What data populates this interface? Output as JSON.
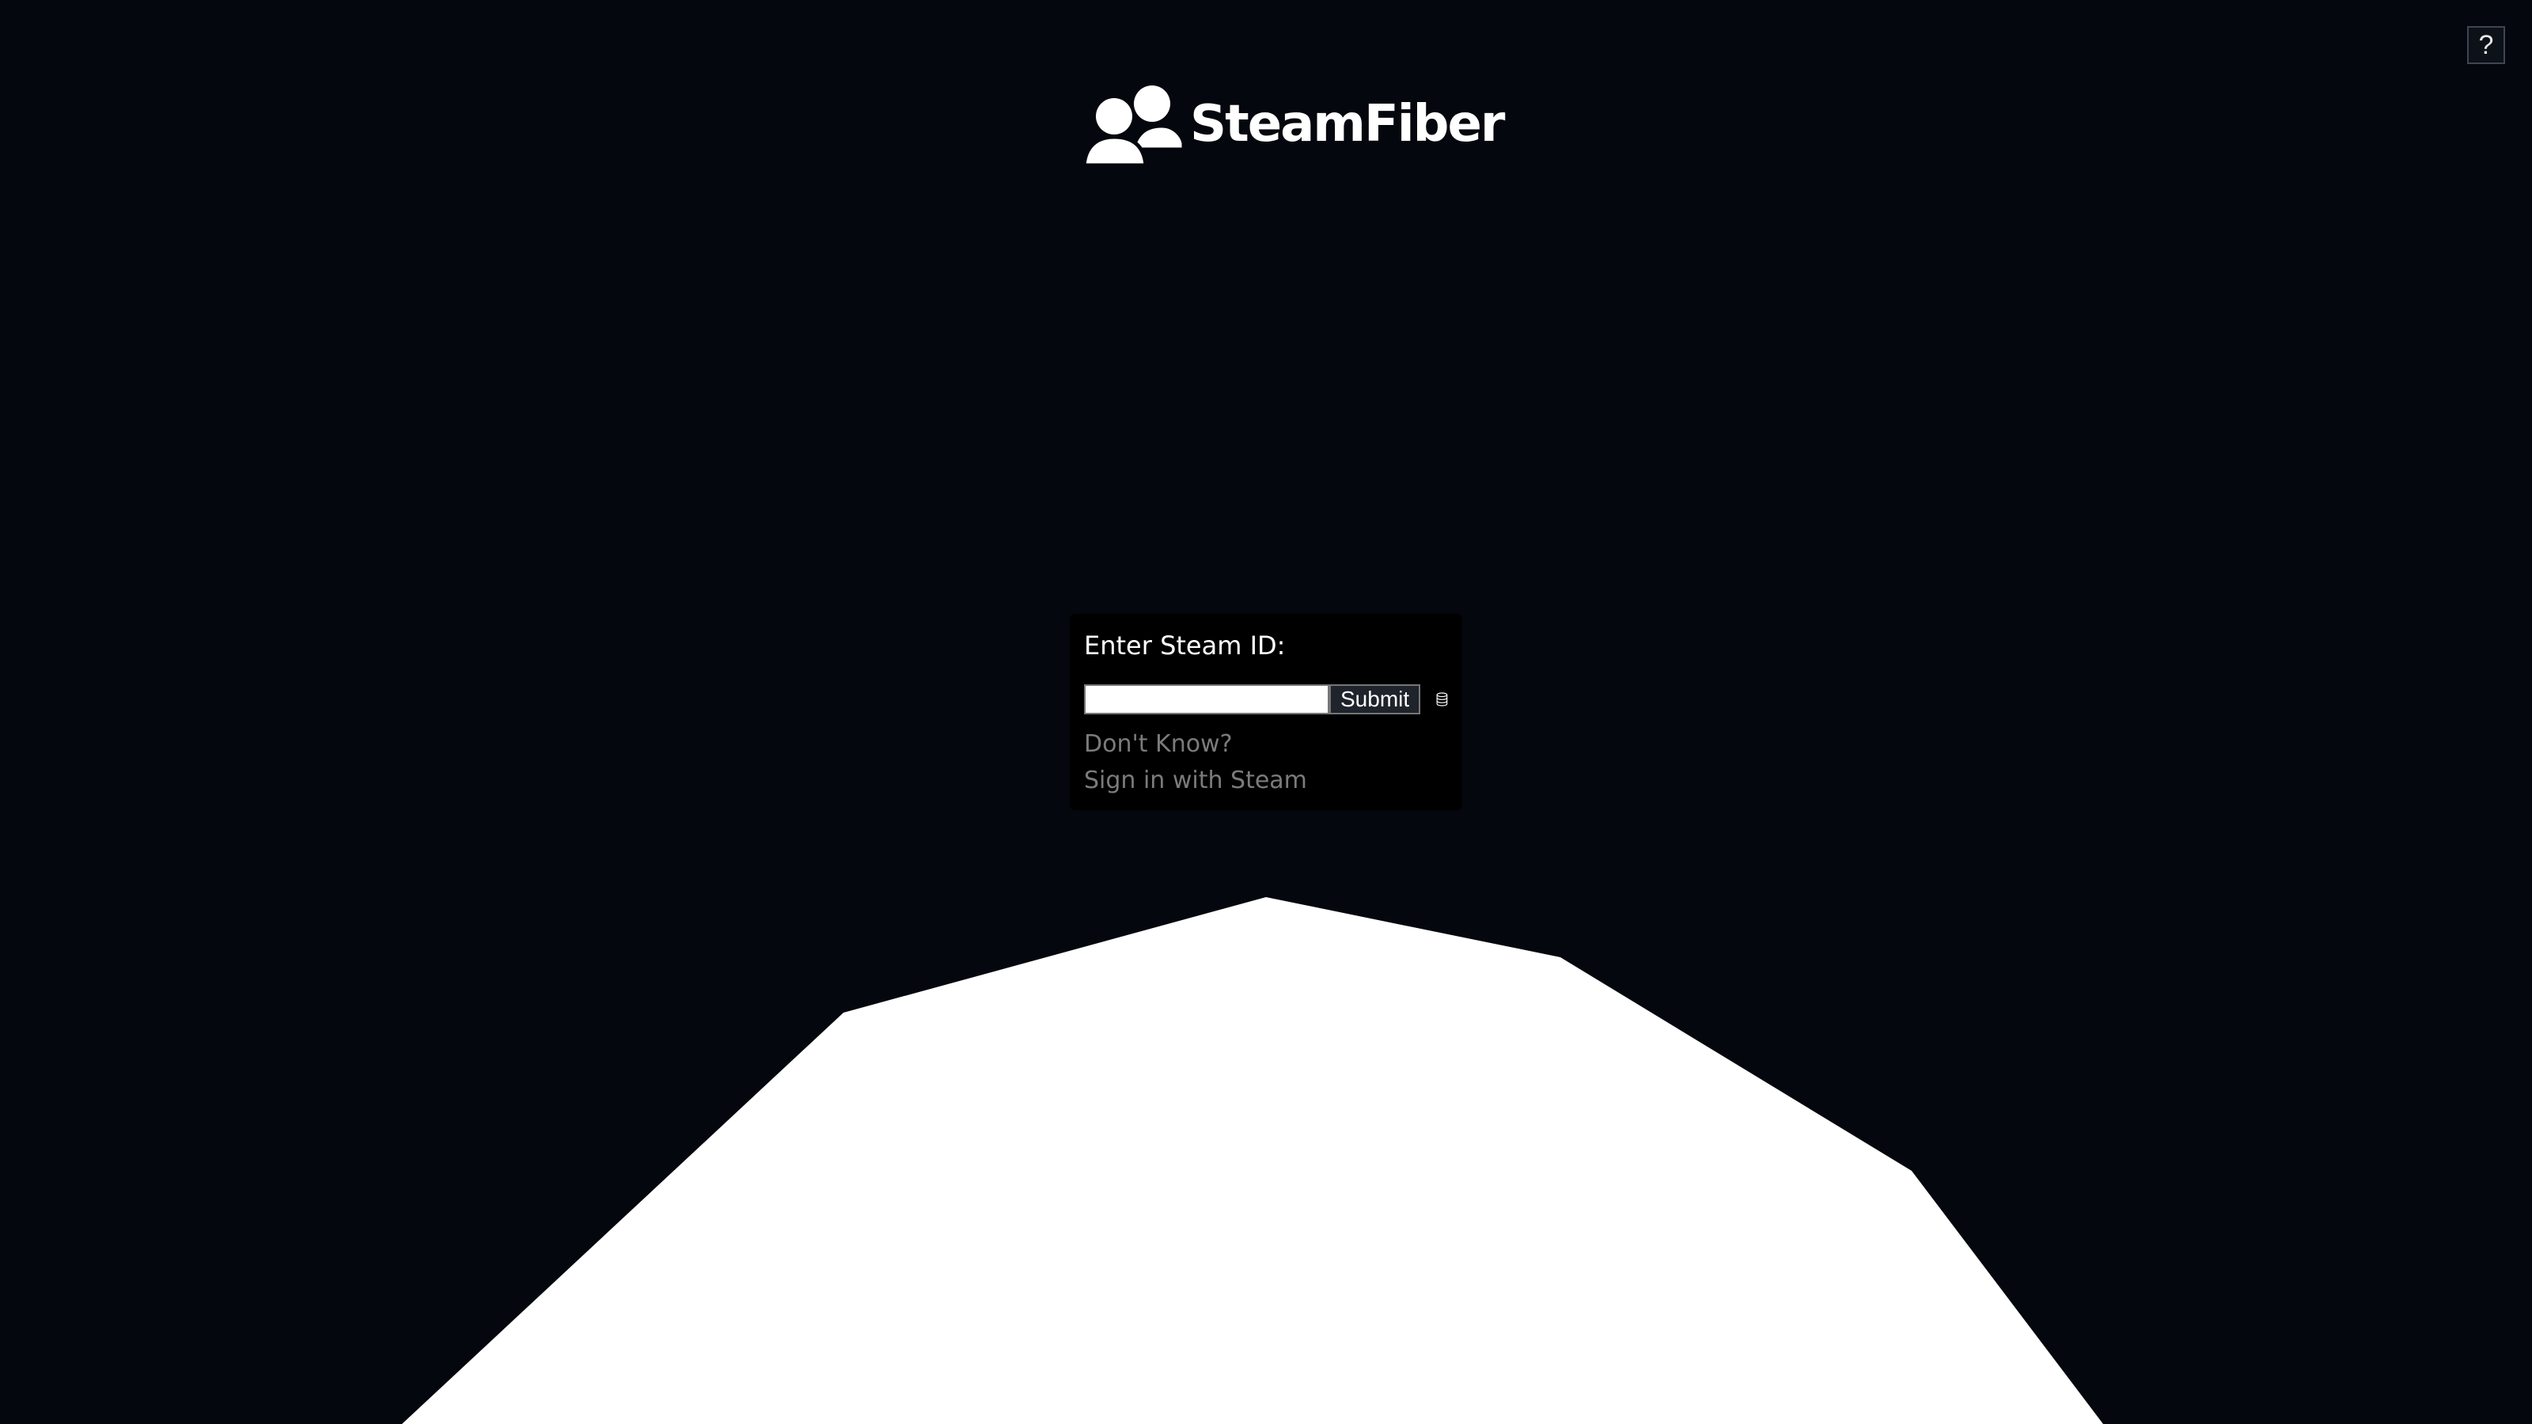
{
  "app": {
    "name": "SteamFiber",
    "logo_icon": "users-icon"
  },
  "help": {
    "label": "?"
  },
  "login_panel": {
    "heading": "Enter Steam ID:",
    "input_value": "",
    "submit_label": "Submit",
    "database_icon": "database-icon",
    "dont_know_label": "Don't Know?",
    "sign_in_label": "Sign in with Steam"
  },
  "colors": {
    "background": "#04070d",
    "panel": "#000000",
    "link": "#7b7b7b",
    "shape": "#ffffff"
  }
}
